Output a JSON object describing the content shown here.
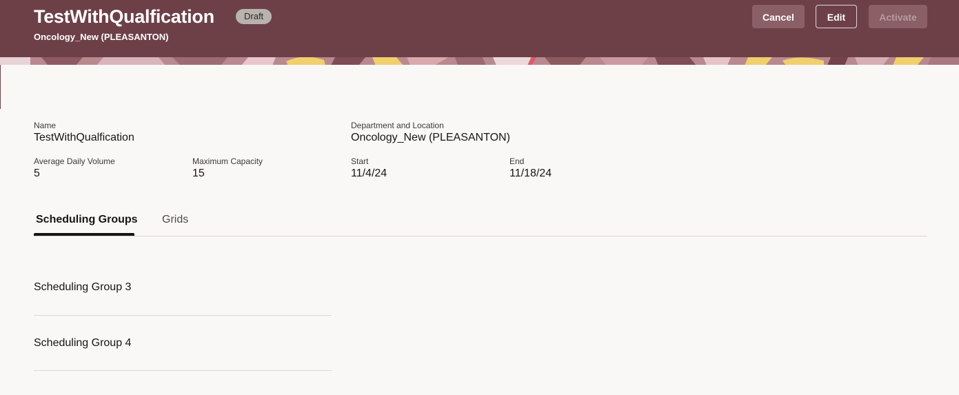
{
  "header": {
    "title": "TestWithQualfication",
    "status_badge": "Draft",
    "subtitle": "Oncology_New (PLEASANTON)",
    "buttons": {
      "cancel": "Cancel",
      "edit": "Edit",
      "activate": "Activate"
    },
    "colors": {
      "background": "#6d4048",
      "banner_yellow": "#f0cf6c",
      "banner_pink": "#c98e95"
    }
  },
  "details": {
    "name": {
      "label": "Name",
      "value": "TestWithQualfication"
    },
    "department_location": {
      "label": "Department and Location",
      "value": "Oncology_New (PLEASANTON)"
    },
    "average_daily_volume": {
      "label": "Average Daily Volume",
      "value": "5"
    },
    "maximum_capacity": {
      "label": "Maximum Capacity",
      "value": "15"
    },
    "start": {
      "label": "Start",
      "value": "11/4/24"
    },
    "end": {
      "label": "End",
      "value": "11/18/24"
    }
  },
  "tabs": [
    {
      "label": "Scheduling Groups",
      "active": true
    },
    {
      "label": "Grids",
      "active": false
    }
  ],
  "scheduling_groups": [
    {
      "label": "Scheduling Group 3"
    },
    {
      "label": "Scheduling Group 4"
    }
  ]
}
